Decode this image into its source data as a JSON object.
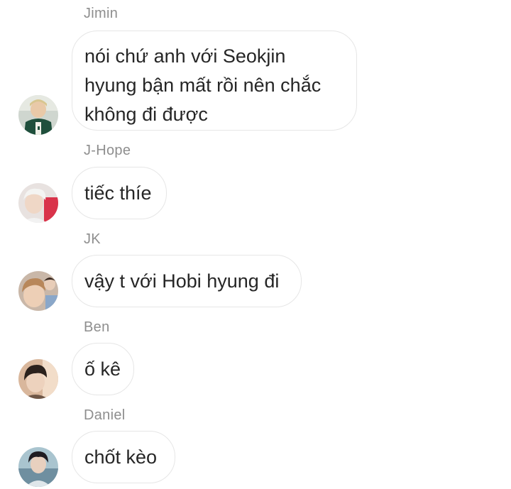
{
  "messages": [
    {
      "sender": "Jimin",
      "text": "nói chứ anh với Seokjin\nhyung bận mất rồi nên chắc\nkhông đi được",
      "avatar_icon": "avatar-jimin"
    },
    {
      "sender": "J-Hope",
      "text": "tiếc thíe",
      "avatar_icon": "avatar-jhope"
    },
    {
      "sender": "JK",
      "text": "vậy t với Hobi hyung đi",
      "avatar_icon": "avatar-jk"
    },
    {
      "sender": "Ben",
      "text": "ố kê",
      "avatar_icon": "avatar-ben"
    },
    {
      "sender": "Daniel",
      "text": "chốt kèo",
      "avatar_icon": "avatar-daniel"
    }
  ],
  "colors": {
    "background": "#ffffff",
    "sender_name": "#8e8e8e",
    "bubble_border": "#e6e6e6",
    "message_text": "#262626"
  }
}
